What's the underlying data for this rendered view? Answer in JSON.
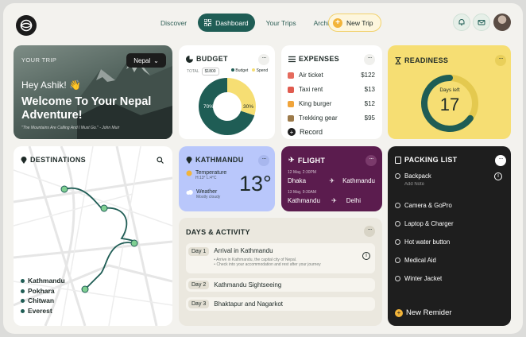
{
  "nav": {
    "items": [
      "Discover",
      "Dashboard",
      "Your Trips",
      "Archive"
    ],
    "new_trip": "New Trip"
  },
  "hero": {
    "your_trip": "YOUR TRIP",
    "selector": "Nepal",
    "hey": "Hey Ashik! 👋",
    "welcome": "Welcome To Your Nepal Adventure!",
    "quote": "\"The Mountains Are Calling And I Must Go.\" - John Muir"
  },
  "budget": {
    "title": "BUDGET",
    "total_label": "TOTAL",
    "total": "$1800",
    "legend_budget": "Budget",
    "legend_spend": "Spend",
    "pct_budget": "70%",
    "pct_spend": "30%",
    "budget_fraction": 0.7,
    "spend_fraction": 0.3,
    "color_budget": "#1f5d55",
    "color_spend": "#f6de73"
  },
  "expenses": {
    "title": "EXPENSES",
    "items": [
      {
        "name": "Air ticket",
        "amount": "$122"
      },
      {
        "name": "Taxi rent",
        "amount": "$13"
      },
      {
        "name": "King burger",
        "amount": "$12"
      },
      {
        "name": "Trekking gear",
        "amount": "$95"
      }
    ],
    "record": "Record"
  },
  "readiness": {
    "title": "READINESS",
    "label": "Days left",
    "days": "17",
    "fraction": 0.65
  },
  "destinations": {
    "title": "DESTINATIONS",
    "list": [
      "Kathmandu",
      "Pokhara",
      "Chitwan",
      "Everest"
    ]
  },
  "weather": {
    "city": "KATHMANDU",
    "temp_label": "Temperature",
    "temp_range": "H:13° L:4°C",
    "weather_label": "Weather",
    "weather_value": "Mostly cloudy",
    "temp": "13°"
  },
  "flight": {
    "title": "FLIGHT",
    "legs": [
      {
        "date": "12 May, 2:30PM",
        "from": "Dhaka",
        "to": "Kathmandu"
      },
      {
        "date": "13 May, 9:30AM",
        "from": "Kathmandu",
        "to": "Delhi"
      }
    ]
  },
  "packing": {
    "title": "PACKING LIST",
    "items": [
      "Backpack",
      "Camera & GoPro",
      "Laptop & Charger",
      "Hot water button",
      "Medical Aid",
      "Winter Jacket"
    ],
    "add_note": "Add Note",
    "new_reminder": "New Remider"
  },
  "days": {
    "title": "DAYS & ACTIVITY",
    "items": [
      {
        "day": "Day 1",
        "name": "Arrival in Kathmandu",
        "notes": [
          "Arrive in Kathmandu, the capital city of Nepal.",
          "Check into your accommodation and rest after your journey"
        ]
      },
      {
        "day": "Day 2",
        "name": "Kathmandu Sightseeing"
      },
      {
        "day": "Day 3",
        "name": "Bhaktapur and Nagarkot"
      }
    ]
  },
  "colors": {
    "primary": "#1f5d55",
    "yellow": "#f6de73",
    "flight": "#5b1c4e",
    "weather": "#b9c7fb"
  }
}
